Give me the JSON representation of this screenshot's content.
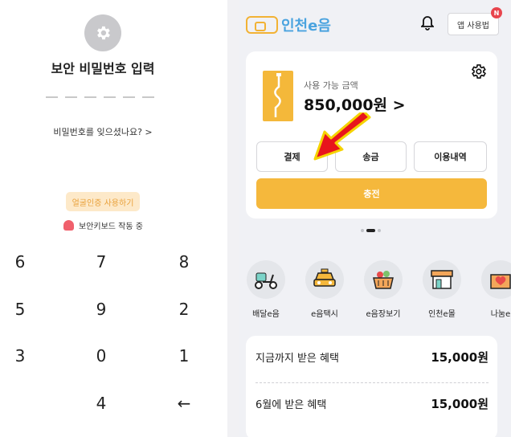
{
  "left": {
    "title": "보안 비밀번호 입력",
    "forgot": "비밀번호를 잊으셨나요?  >",
    "face_auth": "얼굴인증 사용하기",
    "keyboard_status": "보안키보드 작동 중",
    "keys": [
      "6",
      "7",
      "8",
      "5",
      "9",
      "2",
      "3",
      "0",
      "1",
      "4",
      "←"
    ]
  },
  "app": {
    "logo": "인천e음",
    "manual_button": "앱 사용법",
    "badge": "N",
    "card": {
      "balance_label": "사용 가능 금액",
      "balance": "850,000원 >",
      "pay": "결제",
      "transfer": "송금",
      "history": "이용내역",
      "charge": "충전"
    },
    "services": [
      {
        "label": "배달e음",
        "icon": "delivery-scooter-icon"
      },
      {
        "label": "e음택시",
        "icon": "taxi-icon"
      },
      {
        "label": "e음장보기",
        "icon": "grocery-basket-icon"
      },
      {
        "label": "인천e몰",
        "icon": "store-icon"
      },
      {
        "label": "나눔e",
        "icon": "heart-gift-icon"
      }
    ],
    "benefits": [
      {
        "label": "지금까지 받은 혜택",
        "value": "15,000원"
      },
      {
        "label": "6월에 받은 혜택",
        "value": "15,000원"
      }
    ]
  },
  "colors": {
    "accent": "#f5b83c",
    "brand_blue": "#4aa3df",
    "badge_red": "#e8454d",
    "arrow_red": "#e8141c"
  }
}
